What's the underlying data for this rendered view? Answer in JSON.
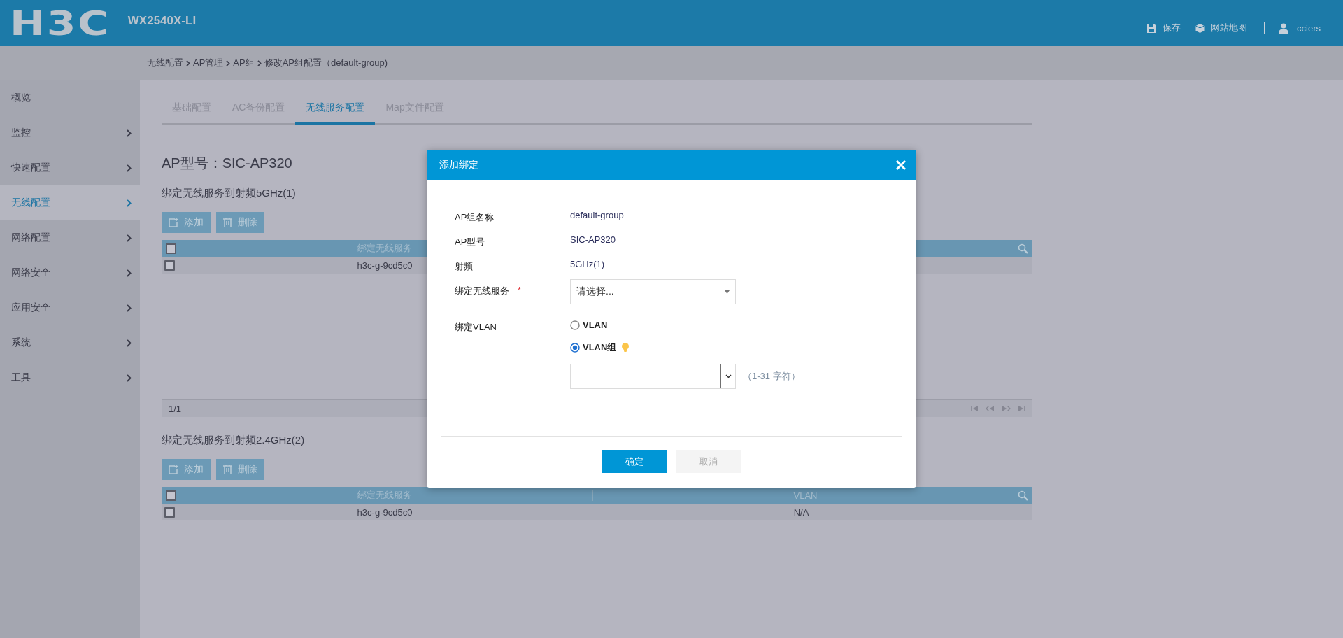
{
  "header": {
    "logo": "H3C",
    "product": "WX2540X-LI",
    "actions": [
      {
        "kind": "save",
        "label": "保存"
      },
      {
        "kind": "sitemap",
        "label": "网站地图"
      }
    ],
    "user": "cciers"
  },
  "breadcrumb": [
    "无线配置",
    "AP管理",
    "AP组",
    "修改AP组配置（default-group)"
  ],
  "sidebar": {
    "items": [
      {
        "label": "概览",
        "expandable": false,
        "selected": false
      },
      {
        "label": "监控",
        "expandable": true,
        "selected": false
      },
      {
        "label": "快速配置",
        "expandable": true,
        "selected": false
      },
      {
        "label": "无线配置",
        "expandable": true,
        "selected": true
      },
      {
        "label": "网络配置",
        "expandable": true,
        "selected": false
      },
      {
        "label": "网络安全",
        "expandable": true,
        "selected": false
      },
      {
        "label": "应用安全",
        "expandable": true,
        "selected": false
      },
      {
        "label": "系统",
        "expandable": true,
        "selected": false
      },
      {
        "label": "工具",
        "expandable": true,
        "selected": false
      }
    ]
  },
  "tabs": [
    {
      "label": "基础配置",
      "selected": false
    },
    {
      "label": "AC备份配置",
      "selected": false
    },
    {
      "label": "无线服务配置",
      "selected": true
    },
    {
      "label": "Map文件配置",
      "selected": false
    }
  ],
  "page_title": "AP型号：SIC-AP320",
  "sections": [
    {
      "title": "绑定无线服务到射频5GHz(1)",
      "buttons": [
        {
          "kind": "add",
          "label": "添加"
        },
        {
          "kind": "delete",
          "label": "删除"
        }
      ],
      "table": {
        "columns": [
          "绑定无线服务"
        ],
        "header_checked": false,
        "rows": [
          {
            "checked": false,
            "cells": [
              "h3c-g-9cd5c0"
            ]
          }
        ],
        "pager": "1/1"
      }
    },
    {
      "title": "绑定无线服务到射频2.4GHz(2)",
      "buttons": [
        {
          "kind": "add",
          "label": "添加"
        },
        {
          "kind": "delete",
          "label": "删除"
        }
      ],
      "table": {
        "columns": [
          "绑定无线服务",
          "VLAN"
        ],
        "header_checked": false,
        "rows": [
          {
            "checked": false,
            "cells": [
              "h3c-g-9cd5c0",
              "N/A"
            ]
          }
        ]
      }
    }
  ],
  "dialog": {
    "title": "添加绑定",
    "fields": [
      {
        "kind": "text",
        "label": "AP组名称",
        "value": "default-group"
      },
      {
        "kind": "text",
        "label": "AP型号",
        "value": "SIC-AP320"
      },
      {
        "kind": "text",
        "label": "射频",
        "value": "5GHz(1)"
      },
      {
        "kind": "select",
        "label": "绑定无线服务",
        "required_mark": "*",
        "placeholder": "请选择..."
      },
      {
        "kind": "radio",
        "label": "绑定VLAN",
        "options": [
          {
            "label": "VLAN",
            "selected": false,
            "tip": false
          },
          {
            "label": "VLAN组",
            "selected": true,
            "tip": true
          }
        ],
        "combo_hint": "（1-31 字符）"
      }
    ],
    "buttons": [
      {
        "kind": "primary",
        "label": "确定"
      },
      {
        "kind": "secondary",
        "label": "取消"
      }
    ]
  }
}
